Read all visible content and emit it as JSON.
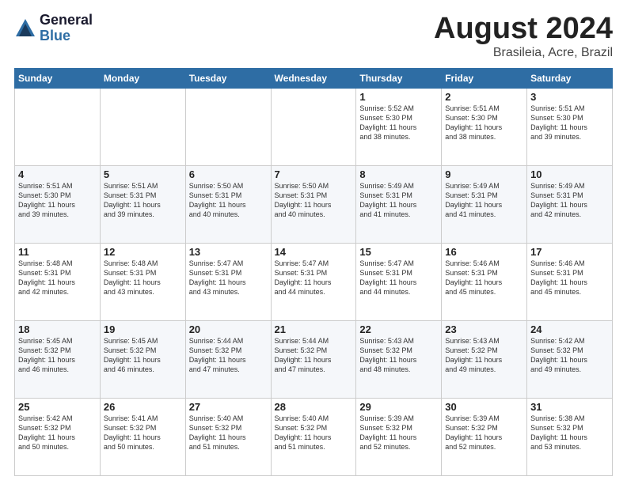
{
  "logo": {
    "general": "General",
    "blue": "Blue"
  },
  "title": "August 2024",
  "subtitle": "Brasileia, Acre, Brazil",
  "days_header": [
    "Sunday",
    "Monday",
    "Tuesday",
    "Wednesday",
    "Thursday",
    "Friday",
    "Saturday"
  ],
  "weeks": [
    [
      {
        "day": "",
        "info": ""
      },
      {
        "day": "",
        "info": ""
      },
      {
        "day": "",
        "info": ""
      },
      {
        "day": "",
        "info": ""
      },
      {
        "day": "1",
        "info": "Sunrise: 5:52 AM\nSunset: 5:30 PM\nDaylight: 11 hours\nand 38 minutes."
      },
      {
        "day": "2",
        "info": "Sunrise: 5:51 AM\nSunset: 5:30 PM\nDaylight: 11 hours\nand 38 minutes."
      },
      {
        "day": "3",
        "info": "Sunrise: 5:51 AM\nSunset: 5:30 PM\nDaylight: 11 hours\nand 39 minutes."
      }
    ],
    [
      {
        "day": "4",
        "info": "Sunrise: 5:51 AM\nSunset: 5:30 PM\nDaylight: 11 hours\nand 39 minutes."
      },
      {
        "day": "5",
        "info": "Sunrise: 5:51 AM\nSunset: 5:31 PM\nDaylight: 11 hours\nand 39 minutes."
      },
      {
        "day": "6",
        "info": "Sunrise: 5:50 AM\nSunset: 5:31 PM\nDaylight: 11 hours\nand 40 minutes."
      },
      {
        "day": "7",
        "info": "Sunrise: 5:50 AM\nSunset: 5:31 PM\nDaylight: 11 hours\nand 40 minutes."
      },
      {
        "day": "8",
        "info": "Sunrise: 5:49 AM\nSunset: 5:31 PM\nDaylight: 11 hours\nand 41 minutes."
      },
      {
        "day": "9",
        "info": "Sunrise: 5:49 AM\nSunset: 5:31 PM\nDaylight: 11 hours\nand 41 minutes."
      },
      {
        "day": "10",
        "info": "Sunrise: 5:49 AM\nSunset: 5:31 PM\nDaylight: 11 hours\nand 42 minutes."
      }
    ],
    [
      {
        "day": "11",
        "info": "Sunrise: 5:48 AM\nSunset: 5:31 PM\nDaylight: 11 hours\nand 42 minutes."
      },
      {
        "day": "12",
        "info": "Sunrise: 5:48 AM\nSunset: 5:31 PM\nDaylight: 11 hours\nand 43 minutes."
      },
      {
        "day": "13",
        "info": "Sunrise: 5:47 AM\nSunset: 5:31 PM\nDaylight: 11 hours\nand 43 minutes."
      },
      {
        "day": "14",
        "info": "Sunrise: 5:47 AM\nSunset: 5:31 PM\nDaylight: 11 hours\nand 44 minutes."
      },
      {
        "day": "15",
        "info": "Sunrise: 5:47 AM\nSunset: 5:31 PM\nDaylight: 11 hours\nand 44 minutes."
      },
      {
        "day": "16",
        "info": "Sunrise: 5:46 AM\nSunset: 5:31 PM\nDaylight: 11 hours\nand 45 minutes."
      },
      {
        "day": "17",
        "info": "Sunrise: 5:46 AM\nSunset: 5:31 PM\nDaylight: 11 hours\nand 45 minutes."
      }
    ],
    [
      {
        "day": "18",
        "info": "Sunrise: 5:45 AM\nSunset: 5:32 PM\nDaylight: 11 hours\nand 46 minutes."
      },
      {
        "day": "19",
        "info": "Sunrise: 5:45 AM\nSunset: 5:32 PM\nDaylight: 11 hours\nand 46 minutes."
      },
      {
        "day": "20",
        "info": "Sunrise: 5:44 AM\nSunset: 5:32 PM\nDaylight: 11 hours\nand 47 minutes."
      },
      {
        "day": "21",
        "info": "Sunrise: 5:44 AM\nSunset: 5:32 PM\nDaylight: 11 hours\nand 47 minutes."
      },
      {
        "day": "22",
        "info": "Sunrise: 5:43 AM\nSunset: 5:32 PM\nDaylight: 11 hours\nand 48 minutes."
      },
      {
        "day": "23",
        "info": "Sunrise: 5:43 AM\nSunset: 5:32 PM\nDaylight: 11 hours\nand 49 minutes."
      },
      {
        "day": "24",
        "info": "Sunrise: 5:42 AM\nSunset: 5:32 PM\nDaylight: 11 hours\nand 49 minutes."
      }
    ],
    [
      {
        "day": "25",
        "info": "Sunrise: 5:42 AM\nSunset: 5:32 PM\nDaylight: 11 hours\nand 50 minutes."
      },
      {
        "day": "26",
        "info": "Sunrise: 5:41 AM\nSunset: 5:32 PM\nDaylight: 11 hours\nand 50 minutes."
      },
      {
        "day": "27",
        "info": "Sunrise: 5:40 AM\nSunset: 5:32 PM\nDaylight: 11 hours\nand 51 minutes."
      },
      {
        "day": "28",
        "info": "Sunrise: 5:40 AM\nSunset: 5:32 PM\nDaylight: 11 hours\nand 51 minutes."
      },
      {
        "day": "29",
        "info": "Sunrise: 5:39 AM\nSunset: 5:32 PM\nDaylight: 11 hours\nand 52 minutes."
      },
      {
        "day": "30",
        "info": "Sunrise: 5:39 AM\nSunset: 5:32 PM\nDaylight: 11 hours\nand 52 minutes."
      },
      {
        "day": "31",
        "info": "Sunrise: 5:38 AM\nSunset: 5:32 PM\nDaylight: 11 hours\nand 53 minutes."
      }
    ]
  ]
}
